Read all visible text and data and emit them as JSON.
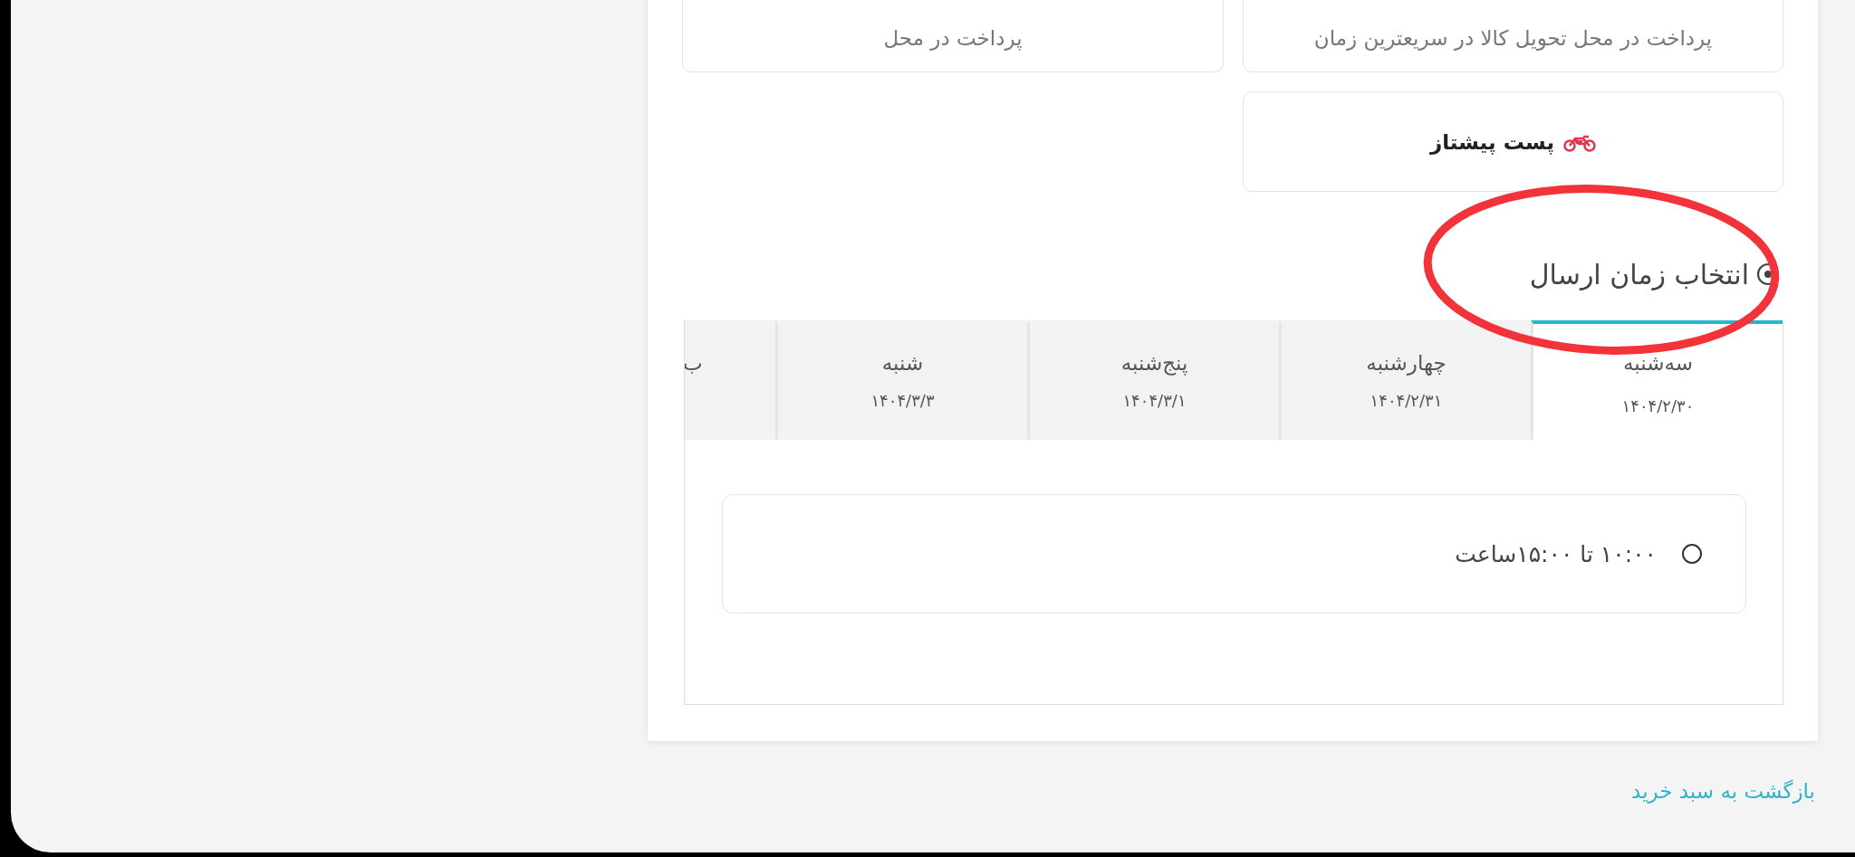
{
  "shipping_options": [
    {
      "subtitle": "پرداخت در محل تحویل کالا در سریعترین زمان"
    },
    {
      "subtitle": "پرداخت در محل"
    },
    {
      "title": "پست پیشتاز",
      "kind": "motorcycle"
    }
  ],
  "delivery_time": {
    "heading": "انتخاب زمان ارسال",
    "days": [
      {
        "label": "سه‌شنبه",
        "date": "۱۴۰۴/۲/۳۰",
        "selected": true
      },
      {
        "label": "چهارشنبه",
        "date": "۱۴۰۴/۲/۳۱",
        "selected": false
      },
      {
        "label": "پنج‌شنبه",
        "date": "۱۴۰۴/۳/۱",
        "selected": false
      },
      {
        "label": "شنبه",
        "date": "۱۴۰۴/۳/۳",
        "selected": false
      },
      {
        "label": "ب",
        "selected": false
      }
    ],
    "slots": [
      {
        "label": "۱۰:۰۰ تا ۱۵:۰۰ساعت",
        "selected": false
      }
    ]
  },
  "back_link": "بازگشت به سبد خرید",
  "annotation": {
    "kind": "ellipse",
    "color": "#f2333a"
  }
}
